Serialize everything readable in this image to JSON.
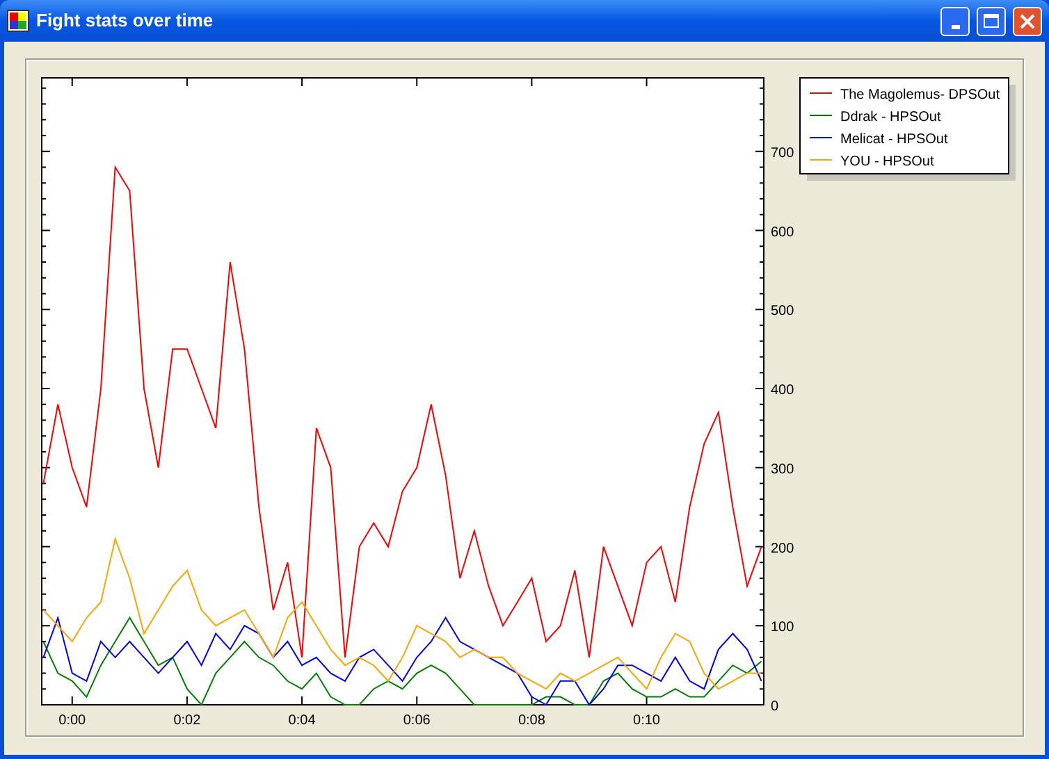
{
  "window": {
    "title": "Fight stats over time"
  },
  "chart": {
    "chart_data": {
      "type": "line",
      "x": [
        -0.5,
        -0.25,
        0,
        0.25,
        0.5,
        0.75,
        1,
        1.25,
        1.5,
        1.75,
        2,
        2.25,
        2.5,
        2.75,
        3,
        3.25,
        3.5,
        3.75,
        4,
        4.25,
        4.5,
        4.75,
        5,
        5.25,
        5.5,
        5.75,
        6,
        6.25,
        6.5,
        6.75,
        7,
        7.25,
        7.5,
        7.75,
        8,
        8.25,
        8.5,
        8.75,
        9,
        9.25,
        9.5,
        9.75,
        10,
        10.25,
        10.5,
        10.75,
        11,
        11.25,
        11.5,
        11.75,
        12
      ],
      "series": [
        {
          "name": "The Magolemus- DPSOut",
          "color": "#ff0000",
          "values": [
            280,
            380,
            300,
            250,
            400,
            680,
            650,
            400,
            300,
            450,
            450,
            400,
            350,
            560,
            450,
            250,
            120,
            180,
            60,
            350,
            300,
            60,
            200,
            230,
            200,
            270,
            300,
            380,
            290,
            160,
            220,
            150,
            100,
            130,
            160,
            80,
            100,
            170,
            60,
            200,
            150,
            100,
            180,
            200,
            130,
            250,
            330,
            370,
            250,
            150,
            200
          ]
        },
        {
          "name": "Ddrak - HPSOut",
          "color": "#008000",
          "values": [
            80,
            40,
            30,
            10,
            50,
            80,
            110,
            80,
            50,
            60,
            20,
            0,
            40,
            60,
            80,
            60,
            50,
            30,
            20,
            40,
            10,
            0,
            0,
            20,
            30,
            20,
            40,
            50,
            40,
            20,
            0,
            0,
            0,
            0,
            0,
            10,
            10,
            0,
            0,
            30,
            40,
            20,
            10,
            10,
            20,
            10,
            10,
            30,
            50,
            40,
            55
          ]
        },
        {
          "name": "Melicat - HPSOut",
          "color": "#0000ff",
          "values": [
            60,
            110,
            40,
            30,
            80,
            60,
            80,
            60,
            40,
            60,
            80,
            50,
            90,
            70,
            100,
            90,
            60,
            80,
            50,
            60,
            40,
            30,
            60,
            70,
            50,
            30,
            60,
            80,
            110,
            80,
            70,
            60,
            50,
            40,
            10,
            0,
            30,
            30,
            0,
            20,
            50,
            50,
            40,
            30,
            60,
            30,
            20,
            70,
            90,
            70,
            30
          ]
        },
        {
          "name": "YOU - HPSOut",
          "color": "#ffa500",
          "values": [
            120,
            100,
            80,
            110,
            130,
            210,
            160,
            90,
            120,
            150,
            170,
            120,
            100,
            110,
            120,
            90,
            60,
            110,
            130,
            100,
            70,
            50,
            60,
            50,
            30,
            60,
            100,
            90,
            80,
            60,
            70,
            60,
            60,
            40,
            30,
            20,
            40,
            30,
            40,
            50,
            60,
            40,
            20,
            60,
            90,
            80,
            40,
            20,
            30,
            40,
            40
          ]
        }
      ],
      "xlim": [
        -0.53,
        12.04
      ],
      "ylim": [
        0,
        793
      ],
      "xticks": [
        {
          "value": 0,
          "label": "0:00"
        },
        {
          "value": 2,
          "label": "0:02"
        },
        {
          "value": 4,
          "label": "0:04"
        },
        {
          "value": 6,
          "label": "0:06"
        },
        {
          "value": 8,
          "label": "0:08"
        },
        {
          "value": 10,
          "label": "0:10"
        }
      ],
      "yticks": [
        0,
        100,
        200,
        300,
        400,
        500,
        600,
        700
      ],
      "legend": true
    }
  }
}
